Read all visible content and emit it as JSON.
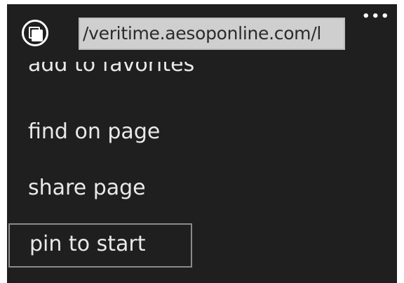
{
  "address_bar": {
    "tabs_icon": "tabs-icon",
    "url": "/veritime.aesoponline.com/l",
    "more_icon": "ellipsis-icon",
    "more_label": "•••"
  },
  "menu": {
    "items": [
      {
        "label": "add to favorites"
      },
      {
        "label": "find on page"
      },
      {
        "label": "share page"
      },
      {
        "label": "pin to start"
      }
    ]
  },
  "colors": {
    "background": "#1f1f1f",
    "text": "#e9e9e9",
    "url_field": "#cfcfcf"
  }
}
